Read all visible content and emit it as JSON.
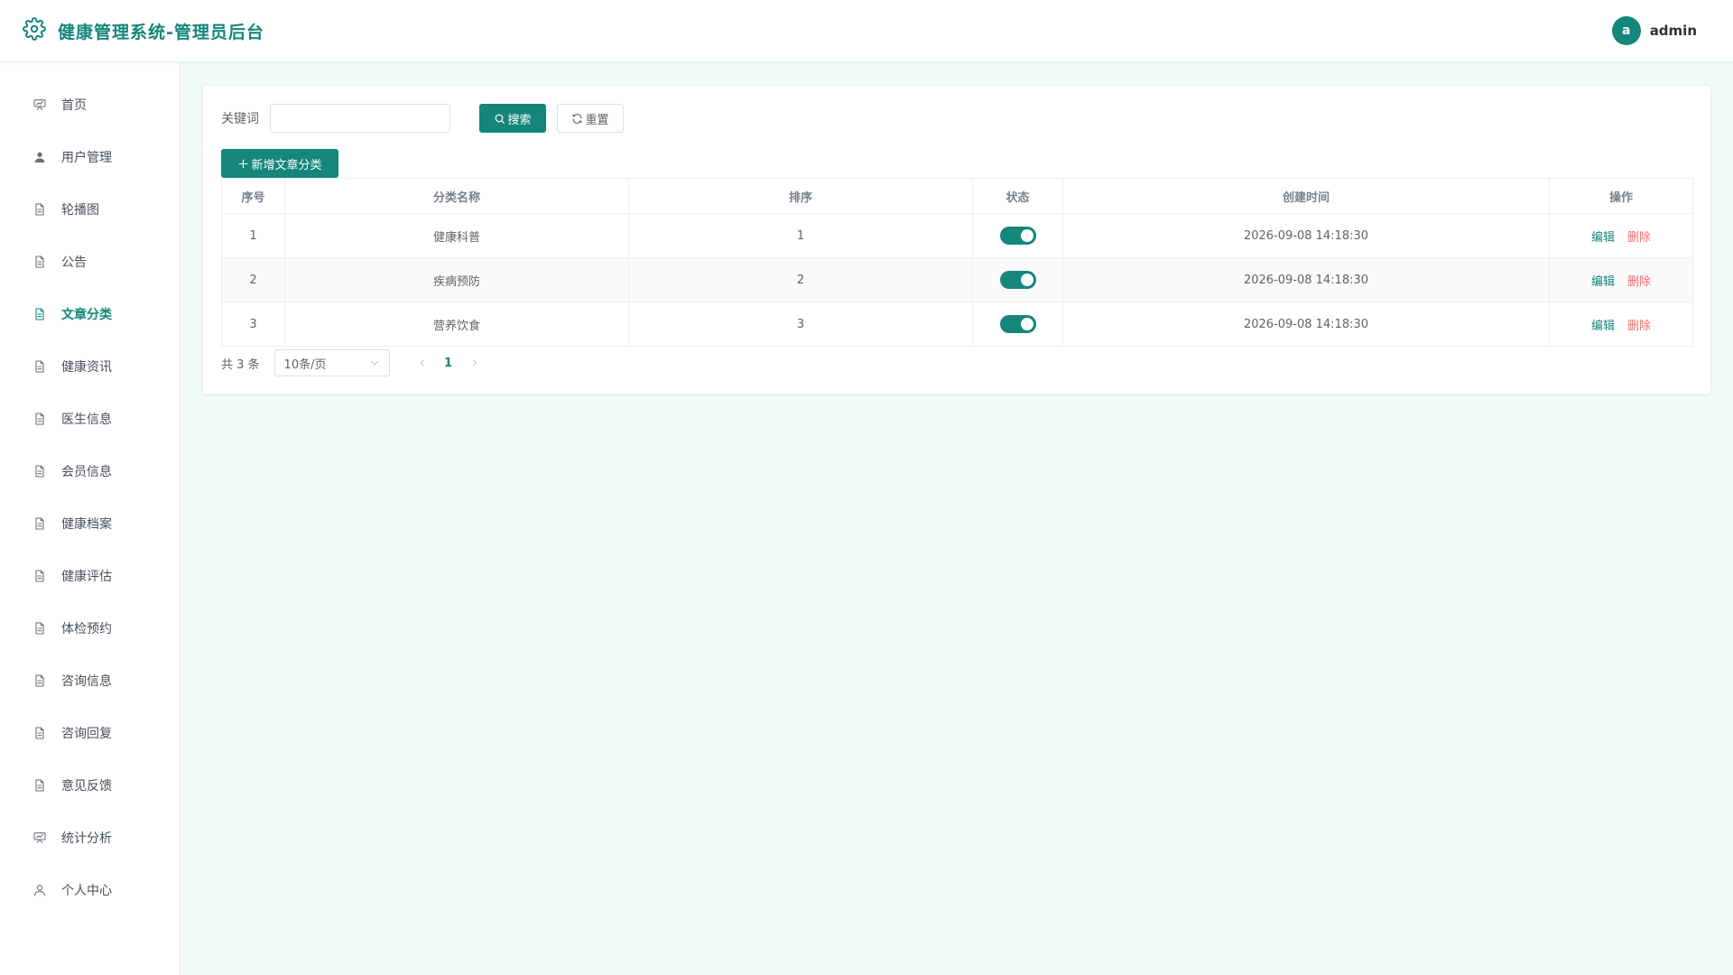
{
  "header": {
    "title": "健康管理系统-管理员后台",
    "avatar_letter": "a",
    "username": "admin"
  },
  "sidebar": {
    "items": [
      {
        "label": "首页",
        "icon": "presentation-icon"
      },
      {
        "label": "用户管理",
        "icon": "user-filled-icon"
      },
      {
        "label": "轮播图",
        "icon": "document-icon"
      },
      {
        "label": "公告",
        "icon": "document-icon"
      },
      {
        "label": "文章分类",
        "icon": "document-icon",
        "active": true
      },
      {
        "label": "健康资讯",
        "icon": "document-icon"
      },
      {
        "label": "医生信息",
        "icon": "document-icon"
      },
      {
        "label": "会员信息",
        "icon": "document-icon"
      },
      {
        "label": "健康档案",
        "icon": "document-icon"
      },
      {
        "label": "健康评估",
        "icon": "document-icon"
      },
      {
        "label": "体检预约",
        "icon": "document-icon"
      },
      {
        "label": "咨询信息",
        "icon": "document-icon"
      },
      {
        "label": "咨询回复",
        "icon": "document-icon"
      },
      {
        "label": "意见反馈",
        "icon": "document-icon"
      },
      {
        "label": "统计分析",
        "icon": "presentation-icon"
      },
      {
        "label": "个人中心",
        "icon": "user-icon"
      }
    ]
  },
  "search": {
    "label": "关键词",
    "value": "",
    "placeholder": "",
    "search_button": "搜索",
    "reset_button": "重置"
  },
  "toolbar": {
    "add_button": "新增文章分类"
  },
  "table": {
    "columns": [
      "序号",
      "分类名称",
      "排序",
      "状态",
      "创建时间",
      "操作"
    ],
    "rows": [
      {
        "index": "1",
        "name": "健康科普",
        "sort": "1",
        "status": true,
        "created": "2026-09-08 14:18:30"
      },
      {
        "index": "2",
        "name": "疾病预防",
        "sort": "2",
        "status": true,
        "created": "2026-09-08 14:18:30"
      },
      {
        "index": "3",
        "name": "营养饮食",
        "sort": "3",
        "status": true,
        "created": "2026-09-08 14:18:30"
      }
    ],
    "edit_label": "编辑",
    "delete_label": "删除"
  },
  "pagination": {
    "total_text": "共 3 条",
    "page_size": "10条/页",
    "current_page": "1"
  },
  "colors": {
    "primary": "#14867a",
    "danger": "#f56c6c",
    "background": "#f0fbf8"
  }
}
